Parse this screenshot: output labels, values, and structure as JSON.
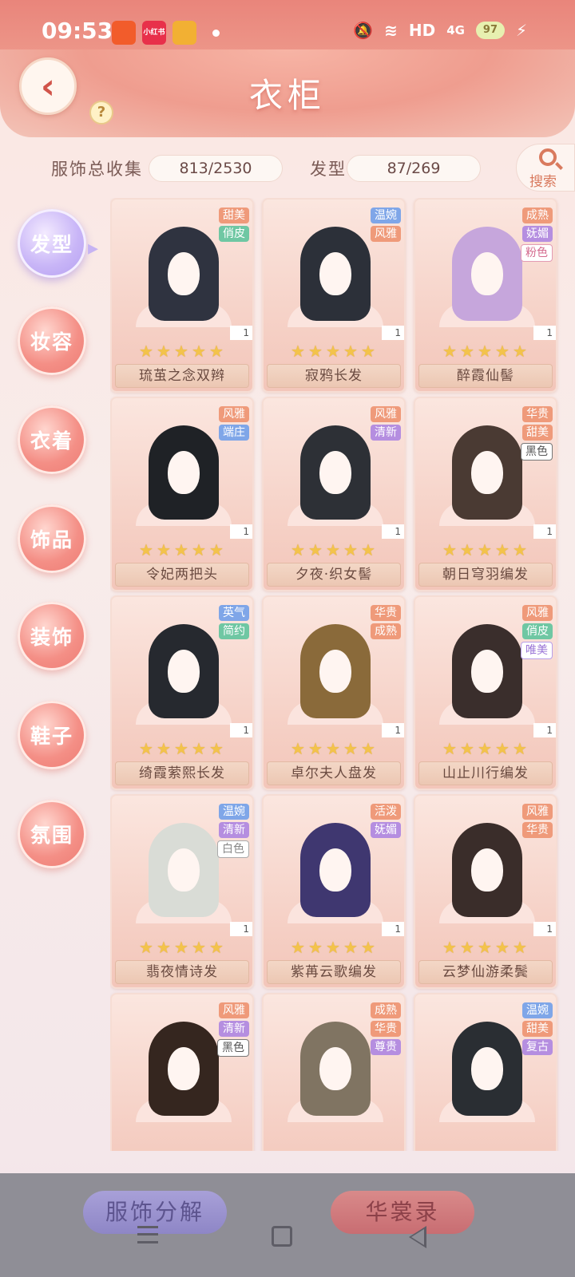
{
  "status_bar": {
    "time": "09:53",
    "apps": [
      {
        "name": "kuaishou-icon",
        "color": "#f25c2b",
        "label": ""
      },
      {
        "name": "xiaohongshu-icon",
        "color": "#e8304a",
        "label": "小红书"
      },
      {
        "name": "weibo-icon",
        "color": "#f2b033",
        "label": ""
      }
    ],
    "network": "HD",
    "cell": "4G",
    "battery": "97"
  },
  "header": {
    "title": "衣柜",
    "back_icon": "back-arrow-icon",
    "help_label": "?"
  },
  "stats": {
    "total_label": "服饰总收集",
    "total_value": "813/2530",
    "category_label": "发型",
    "category_value": "87/269",
    "search_label": "搜索"
  },
  "categories": [
    {
      "label": "发型",
      "active": true
    },
    {
      "label": "妆容",
      "active": false
    },
    {
      "label": "衣着",
      "active": false
    },
    {
      "label": "饰品",
      "active": false
    },
    {
      "label": "装饰",
      "active": false
    },
    {
      "label": "鞋子",
      "active": false
    },
    {
      "label": "氛围",
      "active": false
    }
  ],
  "items": [
    {
      "name": "琉茧之念双辫",
      "count": "1",
      "stars": 5,
      "hair_color": "#2f3340",
      "tags": [
        {
          "text": "甜美",
          "style": "t-orange"
        },
        {
          "text": "俏皮",
          "style": "t-green"
        }
      ]
    },
    {
      "name": "寂鸦长发",
      "count": "1",
      "stars": 5,
      "hair_color": "#2c3039",
      "tags": [
        {
          "text": "温婉",
          "style": "t-blue"
        },
        {
          "text": "风雅",
          "style": "t-orange"
        }
      ]
    },
    {
      "name": "醉霞仙髻",
      "count": "1",
      "stars": 5,
      "hair_color": "#c6a6dc",
      "tags": [
        {
          "text": "成熟",
          "style": "t-orange"
        },
        {
          "text": "妩媚",
          "style": "t-purple"
        },
        {
          "text": "粉色",
          "style": "t-pink"
        }
      ]
    },
    {
      "name": "令妃两把头",
      "count": "1",
      "stars": 5,
      "hair_color": "#1f2226",
      "tags": [
        {
          "text": "风雅",
          "style": "t-orange"
        },
        {
          "text": "端庄",
          "style": "t-blue"
        }
      ]
    },
    {
      "name": "夕夜·织女髻",
      "count": "1",
      "stars": 5,
      "hair_color": "#2d3036",
      "tags": [
        {
          "text": "风雅",
          "style": "t-orange"
        },
        {
          "text": "清新",
          "style": "t-purple"
        }
      ]
    },
    {
      "name": "朝日穹羽编发",
      "count": "1",
      "stars": 5,
      "hair_color": "#4a3a33",
      "tags": [
        {
          "text": "华贵",
          "style": "t-orange"
        },
        {
          "text": "甜美",
          "style": "t-orange"
        },
        {
          "text": "黑色",
          "style": "t-dark"
        }
      ]
    },
    {
      "name": "绮霞萦熙长发",
      "count": "1",
      "stars": 5,
      "hair_color": "#26292f",
      "tags": [
        {
          "text": "英气",
          "style": "t-blue"
        },
        {
          "text": "简约",
          "style": "t-green"
        }
      ]
    },
    {
      "name": "卓尔夫人盘发",
      "count": "1",
      "stars": 5,
      "hair_color": "#8a6a3a",
      "tags": [
        {
          "text": "华贵",
          "style": "t-orange"
        },
        {
          "text": "成熟",
          "style": "t-orange"
        }
      ]
    },
    {
      "name": "山止川行编发",
      "count": "1",
      "stars": 5,
      "hair_color": "#3a2e2c",
      "tags": [
        {
          "text": "风雅",
          "style": "t-orange"
        },
        {
          "text": "俏皮",
          "style": "t-green"
        },
        {
          "text": "唯美",
          "style": "t-lavender"
        }
      ]
    },
    {
      "name": "翡夜情诗发",
      "count": "1",
      "stars": 5,
      "hair_color": "#d9dcd6",
      "tags": [
        {
          "text": "温婉",
          "style": "t-blue"
        },
        {
          "text": "清新",
          "style": "t-purple"
        },
        {
          "text": "白色",
          "style": "t-white"
        }
      ]
    },
    {
      "name": "紫苒云歌编发",
      "count": "1",
      "stars": 5,
      "hair_color": "#3f3770",
      "tags": [
        {
          "text": "活泼",
          "style": "t-orange"
        },
        {
          "text": "妩媚",
          "style": "t-purple"
        }
      ]
    },
    {
      "name": "云梦仙游柔鬓",
      "count": "1",
      "stars": 5,
      "hair_color": "#3a2d2a",
      "tags": [
        {
          "text": "风雅",
          "style": "t-orange"
        },
        {
          "text": "华贵",
          "style": "t-orange"
        }
      ]
    },
    {
      "name": "",
      "count": "",
      "stars": 0,
      "hair_color": "#35261f",
      "tags": [
        {
          "text": "风雅",
          "style": "t-orange"
        },
        {
          "text": "清新",
          "style": "t-purple"
        },
        {
          "text": "黑色",
          "style": "t-dark"
        }
      ]
    },
    {
      "name": "",
      "count": "",
      "stars": 0,
      "hair_color": "#807462",
      "tags": [
        {
          "text": "成熟",
          "style": "t-orange"
        },
        {
          "text": "华贵",
          "style": "t-orange"
        },
        {
          "text": "尊贵",
          "style": "t-purple"
        }
      ]
    },
    {
      "name": "",
      "count": "",
      "stars": 0,
      "hair_color": "#2a2e33",
      "tags": [
        {
          "text": "温婉",
          "style": "t-blue"
        },
        {
          "text": "甜美",
          "style": "t-orange"
        },
        {
          "text": "复古",
          "style": "t-purple"
        }
      ]
    }
  ],
  "bottom": {
    "decompose_label": "服饰分解",
    "record_label": "华裳录"
  }
}
